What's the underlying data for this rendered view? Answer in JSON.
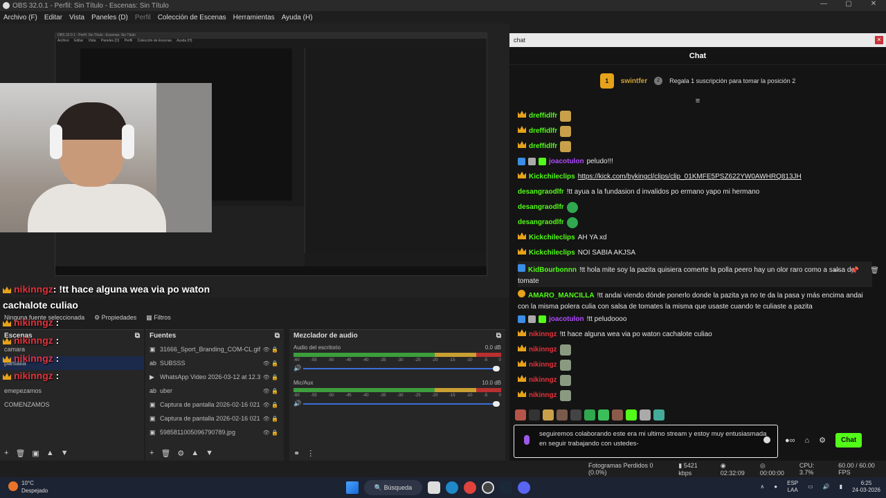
{
  "window": {
    "title": "OBS 32.0.1 - Perfil: Sin Título - Escenas: Sin Título",
    "controls": [
      "—",
      "▢",
      "✕"
    ]
  },
  "menu": {
    "items": [
      "Archivo (F)",
      "Editar",
      "Vista",
      "Paneles (D)",
      "Perfil",
      "Colección de Escenas",
      "Herramientas",
      "Ayuda (H)"
    ]
  },
  "nested": {
    "title": "OBS 32.0.1 - Perfil: Sin Título - Escenas: Sin Título",
    "menu": [
      "Archivo",
      "Editar",
      "Vista",
      "Paneles (D)",
      "Perfil",
      "Colección de Escenas",
      "Ayuda (H)"
    ]
  },
  "overlay": {
    "main_user": "nikinngz",
    "main_text": ": !tt hace alguna wea via po waton",
    "main_text2": "cachalote culiao",
    "repeat_user": "nikinngz",
    "repeat_sep": ":",
    "no_source": "Ninguna fuente seleccionada",
    "properties": "Propiedades",
    "filters": "Filtros"
  },
  "scenes": {
    "title": "Escenas",
    "items": [
      "camara",
      "pantalla",
      "emepezamos",
      "COMENZAMOS"
    ]
  },
  "sources": {
    "title": "Fuentes",
    "items": [
      {
        "icon": "image",
        "label": "31666_Sport_Branding_COM-CL.gif"
      },
      {
        "icon": "text",
        "label": "SUBSSS"
      },
      {
        "icon": "play",
        "label": "WhatsApp Video 2026-03-12 at 12.3"
      },
      {
        "icon": "text",
        "label": "uber"
      },
      {
        "icon": "image",
        "label": "Captura de pantalla 2026-02-16 021"
      },
      {
        "icon": "image",
        "label": "Captura de pantalla 2026-02-16 021"
      },
      {
        "icon": "image",
        "label": "5985811005096790789.jpg"
      }
    ]
  },
  "mixer": {
    "title": "Mezclador de audio",
    "tracks": [
      {
        "name": "Audio del escritorio",
        "db": "0.0 dB"
      },
      {
        "name": "Mic/Aux",
        "db": "10.0 dB"
      }
    ],
    "scale": [
      "-60",
      "-55",
      "-50",
      "-45",
      "-40",
      "-35",
      "-30",
      "-25",
      "-20",
      "-15",
      "-10",
      "-5",
      "0"
    ]
  },
  "chat": {
    "window_title": "chat",
    "header": "Chat",
    "gift": {
      "level": "1",
      "user": "swintfer",
      "text": "Regala 1 suscripción para tomar la posición 2",
      "pos": "2"
    },
    "messages": [
      {
        "user": "dreffidlfr",
        "color": "#53fc18",
        "text": ""
      },
      {
        "user": "dreffidlfr",
        "color": "#53fc18",
        "text": ""
      },
      {
        "user": "dreffidlfr",
        "color": "#53fc18",
        "text": ""
      },
      {
        "user": "joacotulon",
        "color": "#b04aff",
        "text": "peludo!!!"
      },
      {
        "user": "Kickchileclips",
        "color": "#53fc18",
        "text": "https://kick.com/bykingcl/clips/clip_01KMFE5PSZ622YW0AWHRQ813JH"
      },
      {
        "user": "desangraodlfr",
        "color": "#53fc18",
        "text": "!tt ayua a la fundasion d invalidos po ermano yapo mi hermano"
      },
      {
        "user": "desangraodlfr",
        "color": "#53fc18",
        "text": ""
      },
      {
        "user": "desangraodlfr",
        "color": "#53fc18",
        "text": ""
      },
      {
        "user": "Kickchileclips",
        "color": "#53fc18",
        "text": "AH YA xd"
      },
      {
        "user": "Kickchileclips",
        "color": "#53fc18",
        "text": "NOI SABIA AKJSA"
      },
      {
        "user": "KidBourbonnn",
        "color": "#53fc18",
        "text": "!tt hola mite soy la pazita quisiera comerte la polla peero hay un olor raro como a salsa de tomate"
      },
      {
        "user": "AMARO_MANCILLA",
        "color": "#53fc18",
        "text": "!tt andai viendo dónde ponerlo donde la pazita ya no te da la pasa y más encima andai con la misma polera culia con salsa de tomates la misma que usaste cuando te culiaste a pazita"
      },
      {
        "user": "joacotulon",
        "color": "#b04aff",
        "text": "!tt peludoooo"
      },
      {
        "user": "nikinngz",
        "color": "#e0343c",
        "text": "!tt hace alguna wea via po waton cachalote culiao"
      },
      {
        "user": "nikinngz",
        "color": "#e0343c",
        "text": ""
      },
      {
        "user": "nikinngz",
        "color": "#e0343c",
        "text": ""
      },
      {
        "user": "nikinngz",
        "color": "#e0343c",
        "text": ""
      },
      {
        "user": "nikinngz",
        "color": "#e0343c",
        "text": ""
      }
    ],
    "input_text": "seguiremos colaborando este era mi ultimo stream y estoy muy entusiasmada en seguir trabajando con ustedes-",
    "chat_button": "Chat"
  },
  "status": {
    "frames": "Fotogramas Perdidos 0 (0.0%)",
    "kbps": "5421 kbps",
    "stream_time": "02:32:09",
    "rec_time": "00:00:00",
    "cpu": "CPU: 3.7%",
    "fps": "60.00 / 60.00 FPS"
  },
  "taskbar": {
    "temp": "10°C",
    "weather": "Despejado",
    "search": "Búsqueda",
    "lang": "ESP",
    "region": "LAA",
    "time": "6:25",
    "date": "24-03-2026"
  },
  "colors": {
    "kick_green": "#53fc18",
    "accent_red": "#e0343c",
    "obs_bg": "#1f1e1f"
  }
}
